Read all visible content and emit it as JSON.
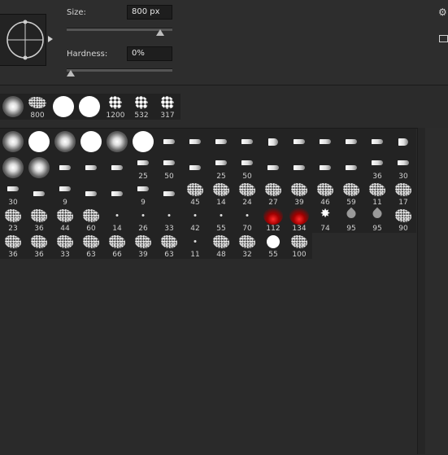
{
  "options": {
    "size_label": "Size:",
    "size_value": "800 px",
    "size_slider_level": 0.95,
    "hardness_label": "Hardness:",
    "hardness_value": "0%",
    "hardness_slider_level": 0.0
  },
  "recent_brushes": [
    {
      "kind": "soft",
      "label": ""
    },
    {
      "kind": "clouds",
      "label": "800"
    },
    {
      "kind": "hard",
      "label": ""
    },
    {
      "kind": "hard",
      "label": ""
    },
    {
      "kind": "figure",
      "label": "1200"
    },
    {
      "kind": "figure",
      "label": "532"
    },
    {
      "kind": "figure",
      "label": "317"
    }
  ],
  "brush_grid": [
    [
      {
        "kind": "soft",
        "label": ""
      },
      {
        "kind": "hard",
        "label": ""
      },
      {
        "kind": "soft",
        "label": ""
      },
      {
        "kind": "hard",
        "label": ""
      },
      {
        "kind": "soft",
        "label": ""
      },
      {
        "kind": "hard",
        "label": ""
      },
      {
        "kind": "tip",
        "label": ""
      },
      {
        "kind": "tip",
        "label": ""
      },
      {
        "kind": "tip",
        "label": ""
      },
      {
        "kind": "tip",
        "label": ""
      },
      {
        "kind": "fan",
        "label": ""
      },
      {
        "kind": "tip",
        "label": ""
      },
      {
        "kind": "tip",
        "label": ""
      },
      {
        "kind": "tip",
        "label": ""
      },
      {
        "kind": "tip",
        "label": ""
      },
      {
        "kind": "fan",
        "label": ""
      }
    ],
    [
      {
        "kind": "soft",
        "label": ""
      },
      {
        "kind": "soft",
        "label": ""
      },
      {
        "kind": "tip",
        "label": ""
      },
      {
        "kind": "tip",
        "label": ""
      },
      {
        "kind": "tip",
        "label": ""
      },
      {
        "kind": "tip",
        "label": "25"
      },
      {
        "kind": "tip",
        "label": "50"
      },
      {
        "kind": "tip",
        "label": ""
      },
      {
        "kind": "tip",
        "label": "25"
      },
      {
        "kind": "tip",
        "label": "50"
      },
      {
        "kind": "tip",
        "label": ""
      },
      {
        "kind": "tip",
        "label": ""
      },
      {
        "kind": "tip",
        "label": ""
      },
      {
        "kind": "tip",
        "label": ""
      },
      {
        "kind": "tip",
        "label": "36"
      },
      {
        "kind": "tip",
        "label": "30"
      }
    ],
    [
      {
        "kind": "tip",
        "label": "30"
      },
      {
        "kind": "tip",
        "label": ""
      },
      {
        "kind": "tip",
        "label": "9"
      },
      {
        "kind": "tip",
        "label": ""
      },
      {
        "kind": "tip",
        "label": ""
      },
      {
        "kind": "tip",
        "label": "9"
      },
      {
        "kind": "tip",
        "label": ""
      },
      {
        "kind": "spatter",
        "label": "45"
      },
      {
        "kind": "spatter",
        "label": "14"
      },
      {
        "kind": "spatter",
        "label": "24"
      },
      {
        "kind": "spatter",
        "label": "27"
      },
      {
        "kind": "spatter",
        "label": "39"
      },
      {
        "kind": "spatter",
        "label": "46"
      },
      {
        "kind": "spatter",
        "label": "59"
      },
      {
        "kind": "spatter",
        "label": "11"
      },
      {
        "kind": "spatter",
        "label": "17"
      }
    ],
    [
      {
        "kind": "spatter",
        "label": "23"
      },
      {
        "kind": "spatter",
        "label": "36"
      },
      {
        "kind": "spatter",
        "label": "44"
      },
      {
        "kind": "spatter",
        "label": "60"
      },
      {
        "kind": "dot",
        "label": "14"
      },
      {
        "kind": "dot",
        "label": "26"
      },
      {
        "kind": "dot",
        "label": "33"
      },
      {
        "kind": "dot",
        "label": "42"
      },
      {
        "kind": "dot",
        "label": "55"
      },
      {
        "kind": "dot",
        "label": "70"
      },
      {
        "kind": "red",
        "label": "112"
      },
      {
        "kind": "red",
        "label": "134"
      },
      {
        "kind": "star",
        "label": "74"
      },
      {
        "kind": "leaf",
        "label": "95"
      },
      {
        "kind": "leaf",
        "label": "95"
      },
      {
        "kind": "spatter",
        "label": "90"
      }
    ],
    [
      {
        "kind": "spatter",
        "label": "36"
      },
      {
        "kind": "spatter",
        "label": "36"
      },
      {
        "kind": "spatter",
        "label": "33"
      },
      {
        "kind": "spatter",
        "label": "63"
      },
      {
        "kind": "spatter",
        "label": "66"
      },
      {
        "kind": "spatter",
        "label": "39"
      },
      {
        "kind": "spatter",
        "label": "63"
      },
      {
        "kind": "dot",
        "label": "11"
      },
      {
        "kind": "spatter",
        "label": "48"
      },
      {
        "kind": "spatter",
        "label": "32"
      },
      {
        "kind": "hard",
        "label": "55"
      },
      {
        "kind": "spatter",
        "label": "100"
      }
    ]
  ],
  "icons": {
    "panel_menu": "gear-icon",
    "preset_menu": "panel-menu-icon",
    "preview": "brush-angle-roundness-preview-icon",
    "flyout": "flyout-arrow-icon"
  },
  "colors": {
    "panel_bg": "#2b2b2b",
    "cell_bg": "#232323",
    "accent_red": "#ff2a2a"
  }
}
